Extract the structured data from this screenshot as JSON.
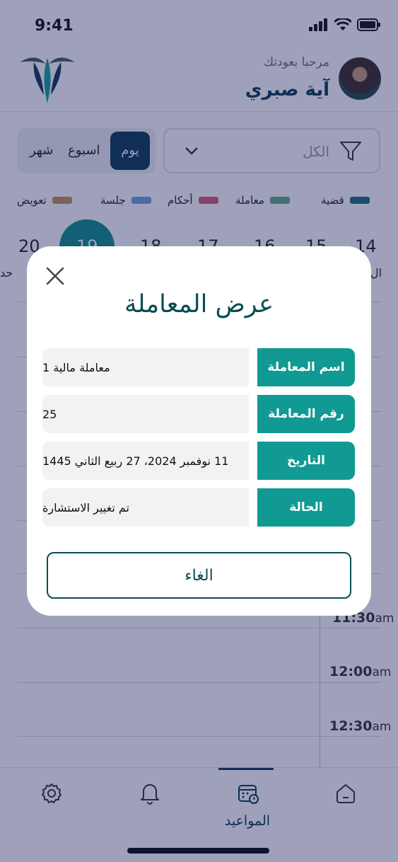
{
  "status_bar": {
    "time": "9:41"
  },
  "header": {
    "welcome": "مرحبا بعودتك",
    "user_name": "آية صبري"
  },
  "filter": {
    "value": "الكل"
  },
  "period_tabs": [
    "شهر",
    "اسبوع",
    "يوم"
  ],
  "period_active": "يوم",
  "legend": [
    {
      "label": "قضية",
      "color": "#1b6e84"
    },
    {
      "label": "معاملة",
      "color": "#5cab8b"
    },
    {
      "label": "أحكام",
      "color": "#d45c78"
    },
    {
      "label": "جلسة",
      "color": "#6ea3e0"
    },
    {
      "label": "تعويض",
      "color": "#c78f57"
    }
  ],
  "days": [
    "20",
    "19",
    "18",
    "17",
    "16",
    "15",
    "14"
  ],
  "day_selected": "19",
  "day_names_partial": {
    "left": "حد",
    "right": "ال"
  },
  "times": [
    {
      "hm": "11:30",
      "suffix": "am"
    },
    {
      "hm": "12:00",
      "suffix": "am"
    },
    {
      "hm": "12:30",
      "suffix": "am"
    }
  ],
  "partial_am": "m",
  "bottom_nav": {
    "active_label": "المواعيد"
  },
  "modal": {
    "title": "عرض المعاملة",
    "rows": [
      {
        "label": "اسم المعاملة",
        "value": "معاملة مالية 1"
      },
      {
        "label": "رقم المعاملة",
        "value": "25"
      },
      {
        "label": "التاريخ",
        "value": "11 نوفمبر 2024،  27 ربيع الثاني 1445"
      },
      {
        "label": "الحالة",
        "value": "تم تغيير الاستشارة"
      }
    ],
    "cancel": "الغاء"
  }
}
